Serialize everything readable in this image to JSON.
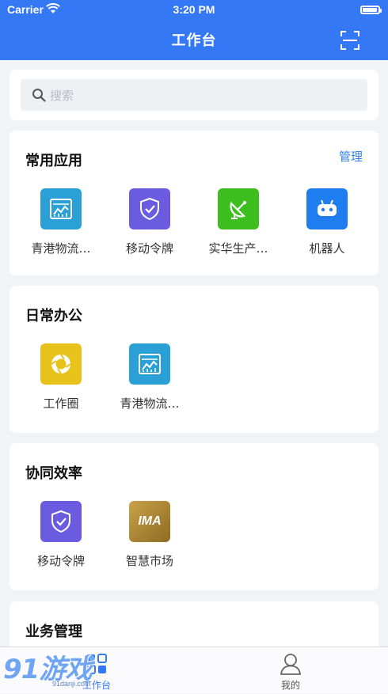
{
  "status_bar": {
    "carrier": "Carrier",
    "time": "3:20 PM"
  },
  "nav": {
    "title": "工作台",
    "scan_icon": "scan-icon"
  },
  "search": {
    "placeholder": "搜索"
  },
  "sections": [
    {
      "title": "常用应用",
      "action": "管理",
      "apps": [
        {
          "label": "青港物流…",
          "icon": "chart-icon",
          "color": "#2aa0d6"
        },
        {
          "label": "移动令牌",
          "icon": "shield-icon",
          "color": "#6b5be0"
        },
        {
          "label": "实华生产…",
          "icon": "satellite-icon",
          "color": "#3cbf1e"
        },
        {
          "label": "机器人",
          "icon": "robot-icon",
          "color": "#1e7ef0"
        }
      ]
    },
    {
      "title": "日常办公",
      "apps": [
        {
          "label": "工作圈",
          "icon": "circle-icon",
          "color": "#e7c21a"
        },
        {
          "label": "青港物流…",
          "icon": "chart-icon",
          "color": "#2aa0d6"
        }
      ]
    },
    {
      "title": "协同效率",
      "apps": [
        {
          "label": "移动令牌",
          "icon": "shield-icon",
          "color": "#6b5be0"
        },
        {
          "label": "智慧市场",
          "icon": "ima-icon",
          "color": "#b58a2e",
          "text": "IMA"
        }
      ]
    },
    {
      "title": "业务管理"
    }
  ],
  "tabbar": {
    "tabs": [
      {
        "label": "工作台",
        "icon": "workbench-icon",
        "active": true
      },
      {
        "label": "我的",
        "icon": "user-icon",
        "active": false
      }
    ]
  },
  "watermark": {
    "big": "91游戏",
    "small": "91danji.com"
  },
  "colors": {
    "primary": "#3478f6",
    "link": "#2f7fe6",
    "background": "#f2f3f7"
  }
}
